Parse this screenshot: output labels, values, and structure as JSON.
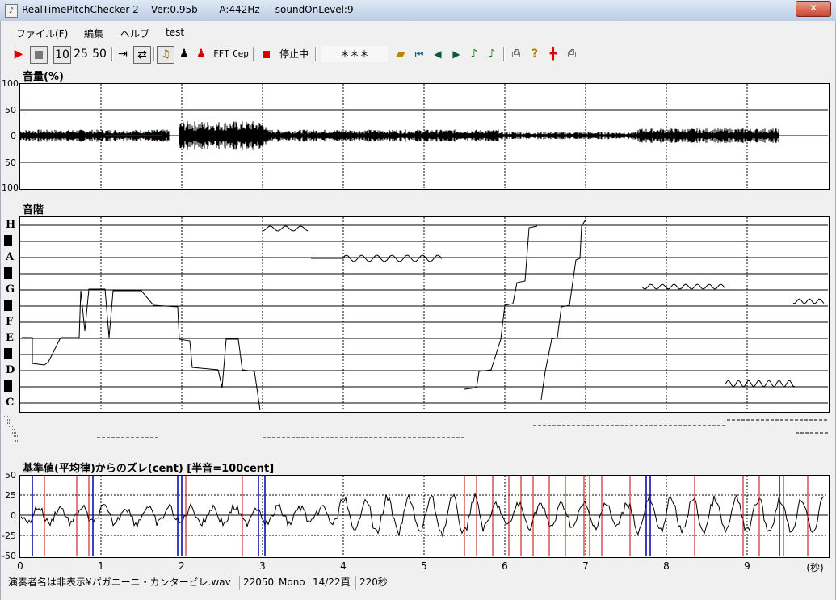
{
  "window": {
    "title": "RealTimePitchChecker 2    Ver:0.95b       A:442Hz     soundOnLevel:9",
    "close_label": "✕",
    "app_icon": "treble-clef-icon"
  },
  "menu": [
    "ファイル(F)",
    "編集",
    "ヘルプ",
    "test"
  ],
  "toolbar": {
    "n10": "10",
    "n25": "25",
    "n50": "50",
    "fft": "FFT",
    "cep": "Cep",
    "status": "停止中",
    "stars": "＊＊＊"
  },
  "sections": {
    "volume_title": "音量(%)",
    "scale_title": "音階",
    "deviation_title": "基準値(平均律)からのズレ(cent) [半音=100cent]"
  },
  "volume_axis": [
    "100",
    "50",
    "0",
    "50",
    "100"
  ],
  "notes": [
    "H",
    "A",
    "G",
    "F",
    "E",
    "D",
    "C"
  ],
  "cent_axis": [
    "50",
    "25",
    "0",
    "-25",
    "-50"
  ],
  "time_axis": [
    "0",
    "1",
    "2",
    "3",
    "4",
    "5",
    "6",
    "7",
    "8",
    "9"
  ],
  "time_unit": "(秒)",
  "status": {
    "file": "演奏者名は非表示¥パガニーニ・カンタービレ.wav",
    "rate": "22050",
    "channel": "Mono",
    "page": "14/22頁",
    "seconds": "220秒"
  },
  "colors": {
    "red_line": "#c00000",
    "blue_line": "#0000b0",
    "trace": "#000000"
  }
}
